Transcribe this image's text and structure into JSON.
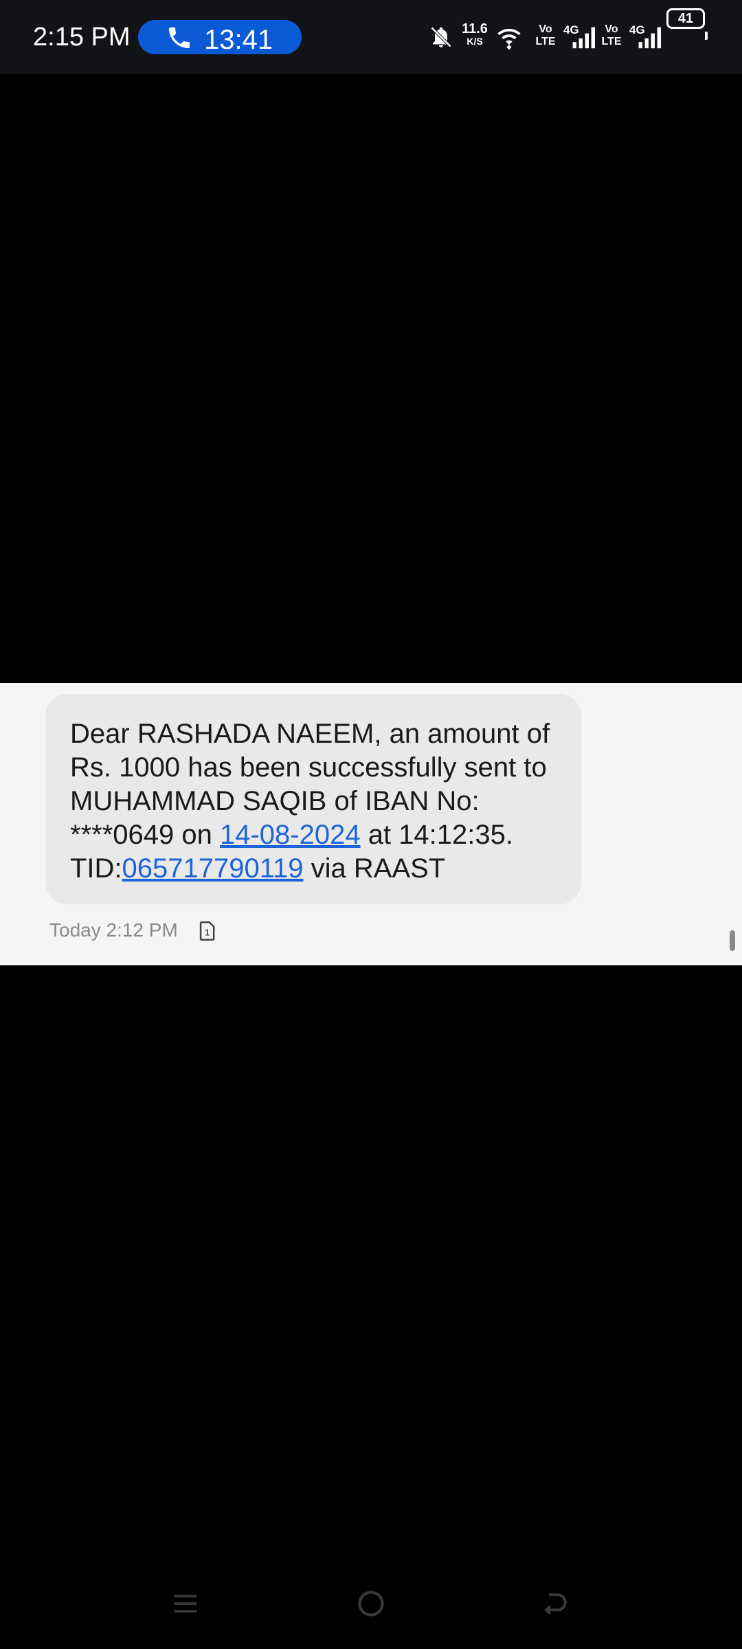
{
  "status_bar": {
    "time": "2:15 PM",
    "call_timer": "13:41",
    "net_speed": "11.6",
    "net_speed_unit": "K/S",
    "volte1": "Vo\nLTE",
    "volte1_a": "Vo",
    "volte1_b": "LTE",
    "signal1_label": "4G",
    "volte2_a": "Vo",
    "volte2_b": "LTE",
    "signal2_label": "4G",
    "battery": "41",
    "icons": [
      "phone-icon",
      "mute-bell-icon",
      "wifi-icon",
      "signal-icon",
      "battery-icon"
    ]
  },
  "message": {
    "text_1": "Dear RASHADA NAEEM, an amount of Rs. 1000 has been successfully sent to MUHAMMAD SAQIB of IBAN No: ****0649 on ",
    "date_link": "14-08-2024",
    "text_2": " at 14:12:35. TID:",
    "tid_link": "065717790119",
    "text_3": " via RAAST",
    "timestamp": "Today 2:12 PM",
    "sim_icon": "sim-1-icon"
  },
  "colors": {
    "status_bg": "#111316",
    "call_pill": "#0a5ad6",
    "panel_bg": "#f5f5f5",
    "bubble_bg": "#e9e9e9",
    "link": "#1d64d8"
  },
  "navbar": {
    "icons": [
      "menu-icon",
      "home-icon",
      "back-icon"
    ]
  }
}
